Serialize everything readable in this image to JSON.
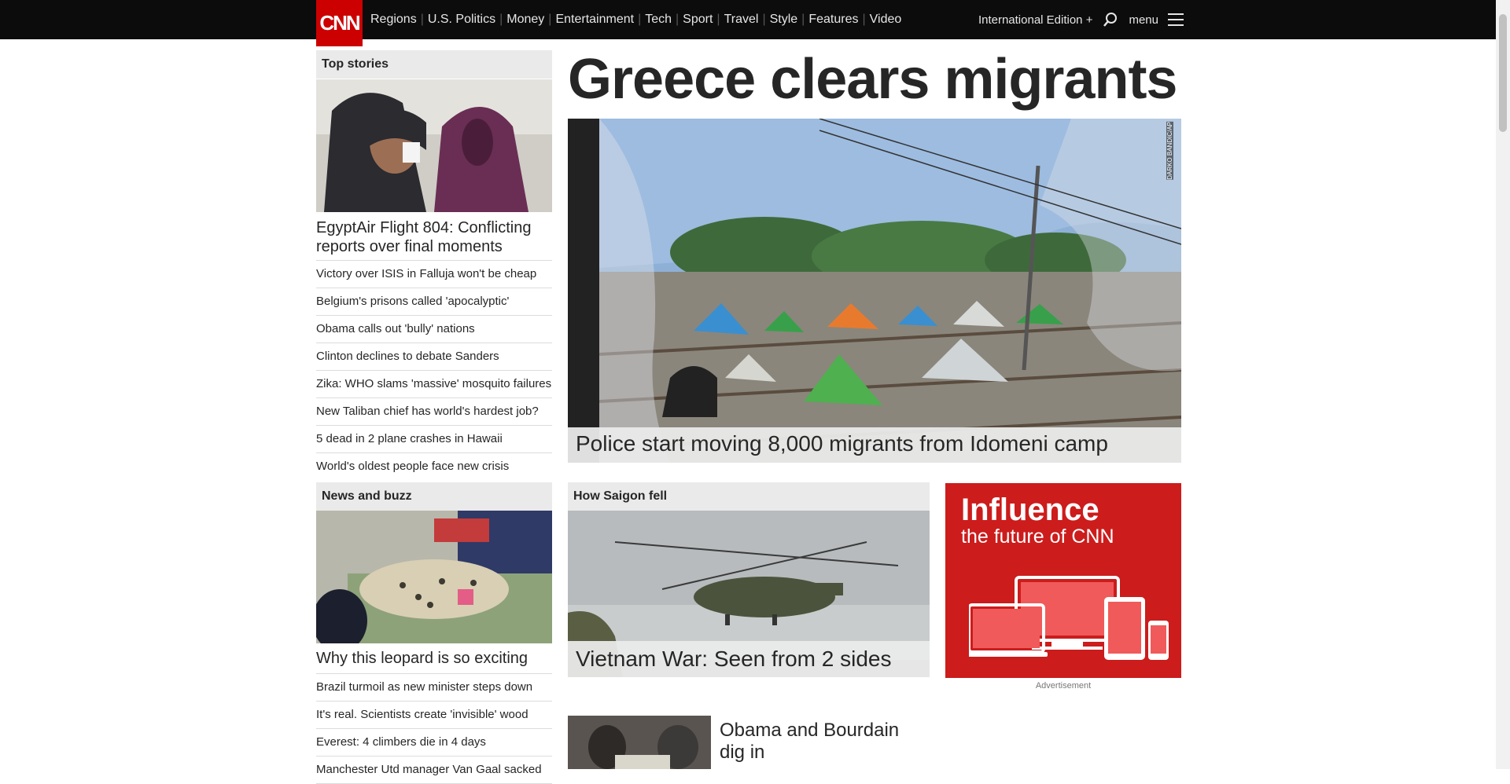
{
  "nav": {
    "logo": "CNN",
    "links": [
      "Regions",
      "U.S. Politics",
      "Money",
      "Entertainment",
      "Tech",
      "Sport",
      "Travel",
      "Style",
      "Features",
      "Video"
    ],
    "edition": "International Edition +",
    "menu_label": "menu"
  },
  "hero": {
    "headline": "Greece clears migrants",
    "caption": "Police start moving 8,000 migrants from Idomeni camp",
    "photo_credit": "DARKO BANDIC/AP"
  },
  "top_stories": {
    "title": "Top stories",
    "lead": "EgyptAir Flight 804: Conflicting reports over final moments",
    "items": [
      "Victory over ISIS in Falluja won't be cheap",
      "Belgium's prisons called 'apocalyptic'",
      "Obama calls out 'bully' nations",
      "Clinton declines to debate Sanders",
      "Zika: WHO slams 'massive' mosquito failures",
      "New Taliban chief has world's hardest job?",
      "5 dead in 2 plane crashes in Hawaii",
      "World's oldest people face new crisis"
    ]
  },
  "news_buzz": {
    "title": "News and buzz",
    "lead": "Why this leopard is so exciting",
    "items": [
      "Brazil turmoil as new minister steps down",
      "It's real. Scientists create 'invisible' wood",
      "Everest: 4 climbers die in 4 days",
      "Manchester Utd manager Van Gaal sacked"
    ]
  },
  "saigon": {
    "title": "How Saigon fell",
    "caption": "Vietnam War: Seen from 2 sides",
    "second_story": "Obama and Bourdain dig in"
  },
  "ad": {
    "title": "Influence",
    "subtitle": "the future of CNN",
    "label": "Advertisement",
    "color": "#cc1c1c"
  },
  "colors": {
    "brand": "#cc0000",
    "nav_bg": "#0c0c0c"
  }
}
